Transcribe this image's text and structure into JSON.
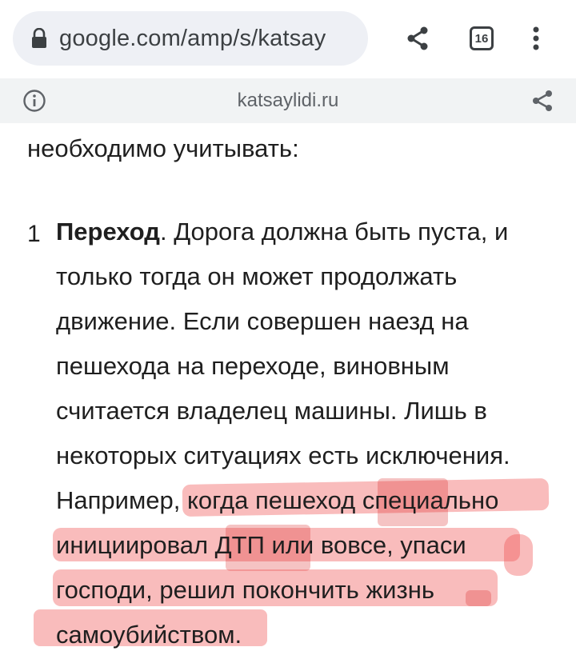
{
  "browser": {
    "url": "google.com/amp/s/katsay",
    "tab_count": "16"
  },
  "amp_header": {
    "domain": "katsaylidi.ru"
  },
  "article": {
    "intro": "необходимо учитывать:",
    "list_number": "1",
    "item_title": "Переход",
    "line1_rest": ". Дорога должна быть пуста, и",
    "line2": "только тогда он может продолжать",
    "line3": "движение. Если совершен наезд на",
    "line4": "пешехода на переходе, виновным",
    "line5": "считается владелец машины. Лишь в",
    "line6": "некоторых ситуациях есть исключения.",
    "line7": "Например, когда пешеход специально",
    "line8": "инициировал ДТП или вовсе, упаси",
    "line9": "господи, решил покончить жизнь",
    "line10": "самоубийством."
  },
  "colors": {
    "highlight": "#ee5050",
    "amp_bar": "#f1f3f4",
    "url_box": "#eef0f5"
  },
  "icons": [
    "lock-icon",
    "share-icon",
    "tabs-icon",
    "more-vert-icon",
    "info-icon",
    "share-icon"
  ]
}
